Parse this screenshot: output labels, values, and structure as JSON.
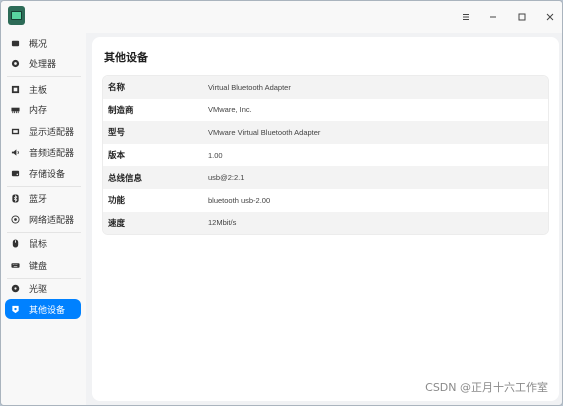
{
  "window": {
    "buttons": [
      "menu",
      "minimize",
      "maximize",
      "close"
    ]
  },
  "sidebar": {
    "items": [
      {
        "label": "概况",
        "icon": "overview-icon"
      },
      {
        "label": "处理器",
        "icon": "cpu-icon"
      },
      {
        "label": "主板",
        "icon": "motherboard-icon"
      },
      {
        "label": "内存",
        "icon": "memory-icon"
      },
      {
        "label": "显示适配器",
        "icon": "display-adapter-icon"
      },
      {
        "label": "音频适配器",
        "icon": "audio-adapter-icon"
      },
      {
        "label": "存储设备",
        "icon": "storage-icon"
      },
      {
        "label": "蓝牙",
        "icon": "bluetooth-icon"
      },
      {
        "label": "网络适配器",
        "icon": "network-icon"
      },
      {
        "label": "鼠标",
        "icon": "mouse-icon"
      },
      {
        "label": "键盘",
        "icon": "keyboard-icon"
      },
      {
        "label": "光驱",
        "icon": "optical-drive-icon"
      },
      {
        "label": "其他设备",
        "icon": "other-devices-icon",
        "active": true
      }
    ]
  },
  "main": {
    "title": "其他设备",
    "rows": [
      {
        "key": "名称",
        "value": "Virtual Bluetooth Adapter"
      },
      {
        "key": "制造商",
        "value": "VMware, Inc."
      },
      {
        "key": "型号",
        "value": "VMware Virtual Bluetooth Adapter"
      },
      {
        "key": "版本",
        "value": "1.00"
      },
      {
        "key": "总线信息",
        "value": "usb@2:2.1"
      },
      {
        "key": "功能",
        "value": "bluetooth usb-2.00"
      },
      {
        "key": "速度",
        "value": "12Mbit/s"
      }
    ]
  },
  "watermark": "CSDN @正月十六工作室",
  "colors": {
    "accent": "#0081ff",
    "app_icon": "#2d6b57"
  }
}
